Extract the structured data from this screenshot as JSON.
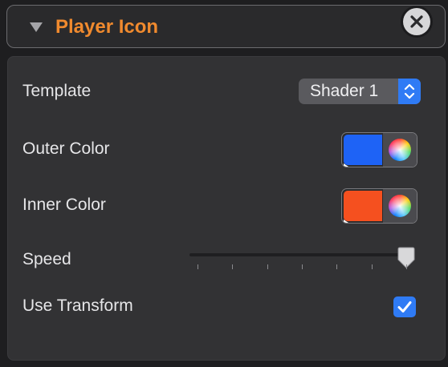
{
  "header": {
    "title": "Player Icon",
    "title_color": "#f08a2e",
    "disclosure_icon": "disclosure-triangle-down",
    "close_icon": "close-circle"
  },
  "panel": {
    "template": {
      "label": "Template",
      "selected": "Shader 1",
      "stepper_icon": "up-down-chevrons"
    },
    "outer_color": {
      "label": "Outer Color",
      "color": "#1e63f6",
      "picker_icon": "color-wheel"
    },
    "inner_color": {
      "label": "Inner Color",
      "color": "#f5501f",
      "picker_icon": "color-wheel"
    },
    "speed": {
      "label": "Speed",
      "value_fraction": 1.0,
      "tick_count": 7
    },
    "use_transform": {
      "label": "Use Transform",
      "checked": true,
      "check_color": "#2f7bf5"
    }
  }
}
